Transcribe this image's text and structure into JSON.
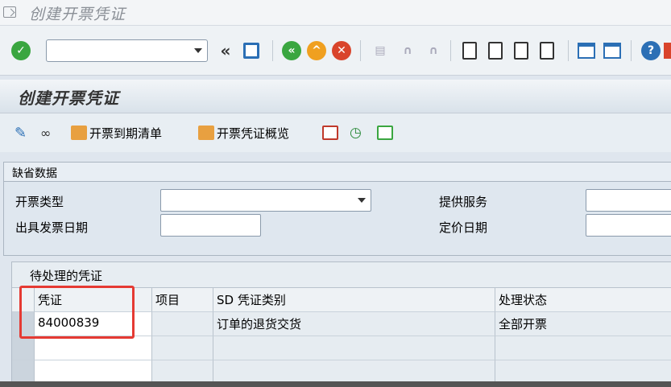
{
  "window": {
    "title": "创建开票凭证"
  },
  "toolbar": {
    "command_value": "",
    "nav_back_glyph": "«"
  },
  "page": {
    "title": "创建开票凭证"
  },
  "app_toolbar": {
    "due_list_label": "开票到期清单",
    "overview_label": "开票凭证概览"
  },
  "default_data": {
    "title": "缺省数据",
    "billing_type_label": "开票类型",
    "billing_type_value": "",
    "billing_date_label": "出具发票日期",
    "billing_date_value": "",
    "serv_rendered_label": "提供服务",
    "serv_rendered_value": "",
    "pricing_date_label": "定价日期",
    "pricing_date_value": ""
  },
  "docs_table": {
    "title": "待处理的凭证",
    "columns": [
      "凭证",
      "项目",
      "SD 凭证类别",
      "处理状态"
    ],
    "rows": [
      [
        "84000839",
        "",
        "订单的退货交货",
        "全部开票"
      ],
      [
        "",
        "",
        "",
        ""
      ],
      [
        "",
        "",
        "",
        ""
      ]
    ]
  },
  "colors": {
    "highlight_box": "#e53a33",
    "accent_green": "#3aa640",
    "accent_orange": "#f0a020",
    "accent_red": "#d9442b"
  }
}
